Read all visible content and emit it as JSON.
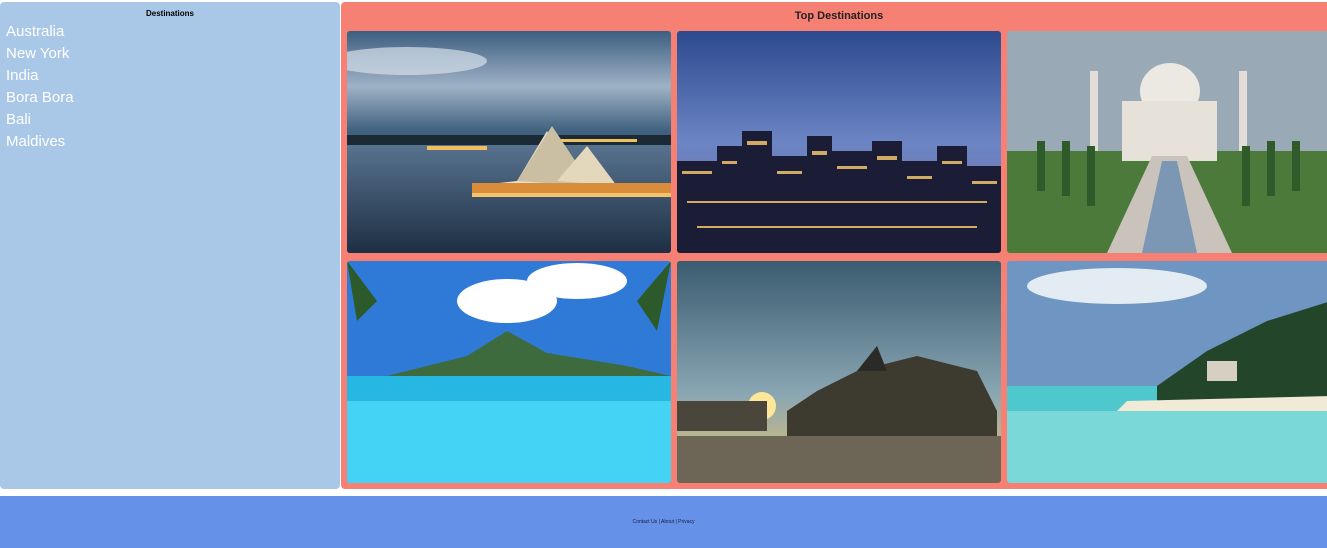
{
  "sidebar": {
    "title": "Destinations",
    "items": [
      {
        "label": "Australia"
      },
      {
        "label": "New York"
      },
      {
        "label": "India"
      },
      {
        "label": "Bora Bora"
      },
      {
        "label": "Bali"
      },
      {
        "label": "Maldives"
      }
    ]
  },
  "main": {
    "title": "Top Destinations",
    "photos": [
      "sydney-opera-house-photo",
      "new-york-skyline-photo",
      "taj-mahal-photo",
      "bora-bora-lagoon-photo",
      "bali-temple-sunset-photo",
      "maldives-beach-photo"
    ]
  },
  "footer": {
    "links_text": "Contact Us | About | Privacy"
  },
  "colors": {
    "sidebar_bg": "#a9c8e8",
    "main_bg": "#f58073",
    "footer_bg": "#6592e8"
  }
}
